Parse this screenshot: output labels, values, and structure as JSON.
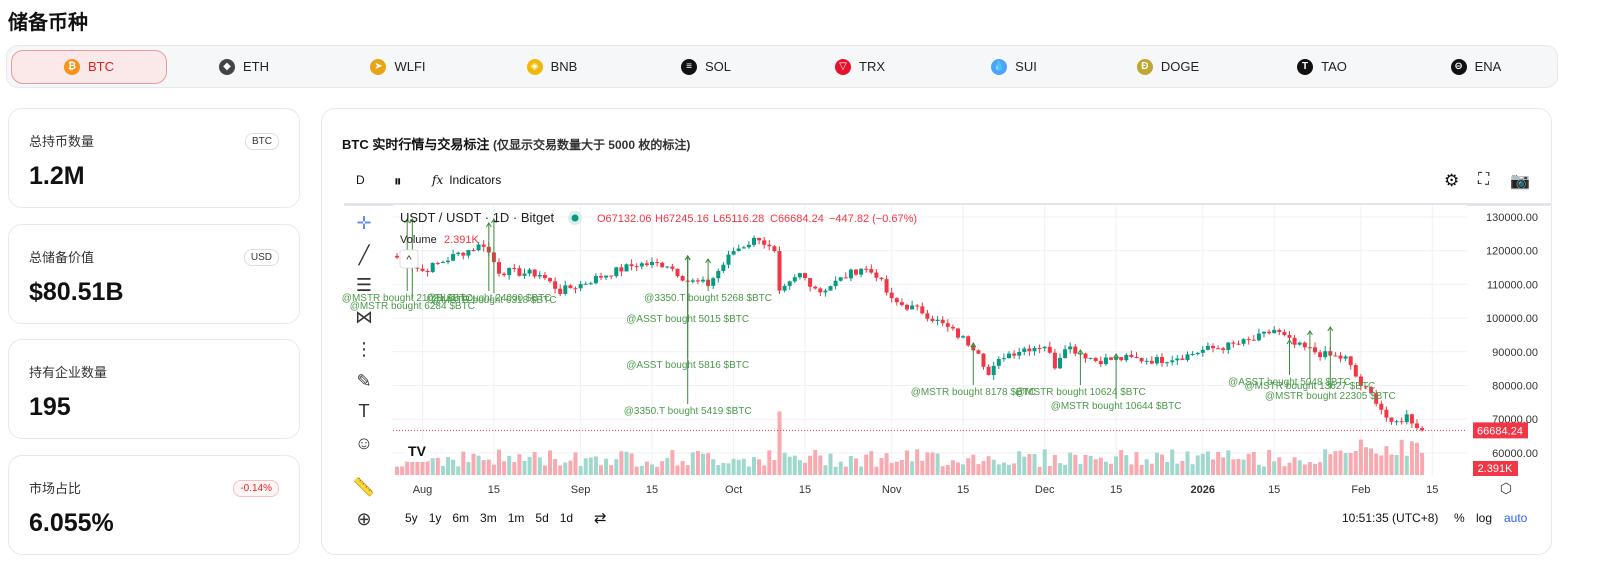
{
  "page_title": "储备币种",
  "coins": [
    {
      "label": "BTC",
      "color": "#f7931a",
      "glyph": "₿",
      "active": true
    },
    {
      "label": "ETH",
      "color": "#444",
      "glyph": "◆"
    },
    {
      "label": "WLFI",
      "color": "#e8a317",
      "glyph": "➤"
    },
    {
      "label": "BNB",
      "color": "#f0b90b",
      "glyph": "◈"
    },
    {
      "label": "SOL",
      "color": "#111",
      "glyph": "≡"
    },
    {
      "label": "TRX",
      "color": "#e8112d",
      "glyph": "▽"
    },
    {
      "label": "SUI",
      "color": "#4da2ff",
      "glyph": "💧"
    },
    {
      "label": "DOGE",
      "color": "#c2a633",
      "glyph": "Ð"
    },
    {
      "label": "TAO",
      "color": "#111",
      "glyph": "T"
    },
    {
      "label": "ENA",
      "color": "#111",
      "glyph": "⊖"
    }
  ],
  "stats": [
    {
      "label": "总持币数量",
      "value": "1.2M",
      "badge": "BTC"
    },
    {
      "label": "总储备价值",
      "value": "$80.51B",
      "badge": "USD"
    },
    {
      "label": "持有企业数量",
      "value": "195"
    },
    {
      "label": "市场占比",
      "value": "6.055%",
      "badge": "-0.14%",
      "badge_negative": true
    }
  ],
  "panel": {
    "title": "BTC 实时行情与交易标注",
    "subtitle": "(仅显示交易数量大于 5000 枚的标注)",
    "interval": "D",
    "indicators": "Indicators",
    "symbol": "USDT / USDT · 1D · Bitget",
    "open": "O67132.06",
    "high": "H67245.16",
    "low": "L65116.28",
    "close": "C66684.24",
    "change": "−447.82 (−0.67%)",
    "volume_label": "Volume",
    "volume_value": "2.391K",
    "last_price": "66684.24",
    "last_volume": "2.391K",
    "ranges": [
      "5y",
      "1y",
      "6m",
      "3m",
      "1m",
      "5d",
      "1d"
    ],
    "time": "10:51:35 (UTC+8)",
    "pct": "%",
    "log": "log",
    "auto": "auto"
  },
  "chart_data": {
    "type": "candlestick",
    "y_ticks": [
      "130000.00",
      "120000.00",
      "110000.00",
      "100000.00",
      "90000.00",
      "80000.00",
      "70000.00",
      "60000.00"
    ],
    "ylim": [
      57000,
      133000
    ],
    "x_ticks": [
      {
        "label": "Aug",
        "day": 5
      },
      {
        "label": "15",
        "day": 19
      },
      {
        "label": "Sep",
        "day": 36
      },
      {
        "label": "15",
        "day": 50
      },
      {
        "label": "Oct",
        "day": 66
      },
      {
        "label": "15",
        "day": 80
      },
      {
        "label": "Nov",
        "day": 97
      },
      {
        "label": "15",
        "day": 111
      },
      {
        "label": "Dec",
        "day": 127
      },
      {
        "label": "15",
        "day": 141
      },
      {
        "label": "2026",
        "day": 158
      },
      {
        "label": "15",
        "day": 172
      },
      {
        "label": "Feb",
        "day": 189
      },
      {
        "label": "15",
        "day": 203
      }
    ],
    "close_keypoints": [
      [
        0,
        118000
      ],
      [
        5,
        114000
      ],
      [
        12,
        119000
      ],
      [
        17,
        122000
      ],
      [
        20,
        114000
      ],
      [
        28,
        113000
      ],
      [
        32,
        108000
      ],
      [
        36,
        110000
      ],
      [
        41,
        113000
      ],
      [
        47,
        116000
      ],
      [
        53,
        116000
      ],
      [
        57,
        111000
      ],
      [
        61,
        110000
      ],
      [
        66,
        120000
      ],
      [
        71,
        124000
      ],
      [
        74,
        119000
      ],
      [
        75,
        107000
      ],
      [
        79,
        113000
      ],
      [
        83,
        108000
      ],
      [
        91,
        115000
      ],
      [
        94,
        113000
      ],
      [
        97,
        105000
      ],
      [
        103,
        102000
      ],
      [
        109,
        96000
      ],
      [
        114,
        90500
      ],
      [
        116,
        83000
      ],
      [
        119,
        89000
      ],
      [
        123,
        91000
      ],
      [
        127,
        92000
      ],
      [
        129,
        86000
      ],
      [
        131,
        92000
      ],
      [
        137,
        87500
      ],
      [
        143,
        88000
      ],
      [
        149,
        87500
      ],
      [
        155,
        89000
      ],
      [
        158,
        90500
      ],
      [
        164,
        92000
      ],
      [
        168,
        93500
      ],
      [
        172,
        96500
      ],
      [
        176,
        92000
      ],
      [
        182,
        89000
      ],
      [
        186,
        88000
      ],
      [
        189,
        80000
      ],
      [
        192,
        75700
      ],
      [
        195,
        68000
      ],
      [
        198,
        71000
      ],
      [
        201,
        66684
      ]
    ],
    "annotations": [
      {
        "day": 2,
        "label": "@MSTR bought 21021 $BTC"
      },
      {
        "day": 3,
        "label": "@MSTR bought 6284 $BTC"
      },
      {
        "day": 18,
        "label": "@BLGI bought 24000 $BTC"
      },
      {
        "day": 19,
        "label": "@MSTR bought 6318 $BTC"
      },
      {
        "day": 61,
        "label": "@3350.T bought 5268 $BTC"
      },
      {
        "day": 57,
        "label": "@ASST bought 5015 $BTC"
      },
      {
        "day": 57,
        "label": "@ASST bought 5816 $BTC"
      },
      {
        "day": 57,
        "label": "@3350.T bought 5419 $BTC"
      },
      {
        "day": 113,
        "label": "@MSTR bought 8178 $BTC"
      },
      {
        "day": 134,
        "label": "@MSTR bought 10624 $BTC"
      },
      {
        "day": 141,
        "label": "@MSTR bought 10644 $BTC"
      },
      {
        "day": 175,
        "label": "@ASST bought 5048 $BTC"
      },
      {
        "day": 179,
        "label": "@MSTR bought 13627 $BTC"
      },
      {
        "day": 183,
        "label": "@MSTR bought 22305 $BTC"
      }
    ]
  }
}
